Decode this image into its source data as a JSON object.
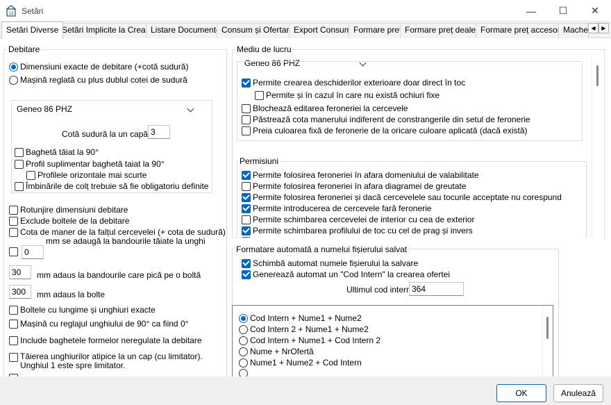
{
  "window": {
    "title": "Setări",
    "minimize_glyph": "—",
    "maximize_glyph": "☐",
    "close_glyph": "✕"
  },
  "tabs": [
    {
      "label": "Setări Diverse"
    },
    {
      "label": "Setări Implicite la Creare"
    },
    {
      "label": "Listare Documente"
    },
    {
      "label": "Consum și Ofertare"
    },
    {
      "label": "Export Consum"
    },
    {
      "label": "Formare preț"
    },
    {
      "label": "Formare preț dealer"
    },
    {
      "label": "Formare preț accesorii"
    },
    {
      "label": "Machet"
    }
  ],
  "tab_scroll": {
    "left": "◀",
    "right": "▶"
  },
  "debitare": {
    "title": "Debitare",
    "radio_exact": "Dimensiuni exacte de debitare (+cotă sudură)",
    "radio_reglata": "Mașină reglată cu plus dublul cotei de sudură",
    "profile_combo": "Geneo 86 PHZ",
    "cota_label": "Cotă sudură la un capăt:",
    "cota_value": "3",
    "bagheta_90": "Baghetă tăiat la 90°",
    "profil_supl": "Profil suplimentar baghetă taiat la 90°",
    "profile_oriz": "Profilele orizontale mai scurte",
    "imbinari": "Îmbinările de colț trebuie să fie obligatoriu definite",
    "rotunjire": "Rotunjire dimensiuni debitare",
    "exclude_boltele": "Exclude boltele de la debitare",
    "cota_maner": "Cota de maner de la falțul cercevelei (+ cota de sudură)",
    "mm_bandouri": "mm se adaugă la bandourile tăiate la unghi",
    "mm_bandouri_value": "0",
    "bolta_value": "30",
    "bolta_label": "mm adaus la bandourile care pică pe o boltă",
    "bolte_value": "300",
    "bolte_label": "mm adaus la bolte",
    "boltele_lungime": "Boltele cu lungime și unghiuri exacte",
    "masina_reglaj": "Mașină cu reglajul unghiului  de 90° ca fiind 0°",
    "include_baghete": "Include baghetele formelor neregulate la debitare",
    "taiere_unghiuri": "Tăierea unghiurilor atipice la un cap (cu limitator). Unghiul 1 este spre limitator."
  },
  "mediu": {
    "title": "Mediu de lucru",
    "profile_combo": "Geneo 86 PHZ",
    "items": [
      {
        "label": "Permite crearea deschiderilor exterioare doar direct în toc",
        "checked": true
      },
      {
        "label": "Permite și în cazul în care nu există ochiuri fixe",
        "checked": false
      },
      {
        "label": "Blochează editarea feroneriei la cercevele",
        "checked": false
      },
      {
        "label": "Păstrează cota manerului indiferent de constrangerile din setul de feronerie",
        "checked": false
      },
      {
        "label": "Preia culoarea fixă de feronerie de la oricare culoare aplicată (dacă există)",
        "checked": false
      }
    ]
  },
  "permisiuni": {
    "title": "Permisiuni",
    "items": [
      {
        "label": "Permite folosirea feroneriei în afara domeniului de valabilitate",
        "checked": true
      },
      {
        "label": "Permite folosirea feroneriei în afara diagramei de greutate",
        "checked": false
      },
      {
        "label": "Permite folosirea feroneriei și dacă cercevelele sau tocurile acceptate nu corespund",
        "checked": true
      },
      {
        "label": "Permite introducerea de cercevele fară feronerie",
        "checked": true
      },
      {
        "label": "Permite schimbarea cercevelei de interior cu cea de exterior",
        "checked": false
      },
      {
        "label": "Permite schimbarea profilului de toc cu cel de prag și invers",
        "checked": true
      }
    ]
  },
  "formatare": {
    "title": "Formatare automată a numelui fișierului salvat",
    "schimba": "Schimbă automat numele fișierului la salvare",
    "genereaza": "Generează automat un \"Cod Intern\" la crearea ofertei",
    "ultimul_label": "Ultimul cod intern:",
    "ultimul_value": "364",
    "options": [
      {
        "label": "Cod Intern + Nume1 + Nume2",
        "checked": true
      },
      {
        "label": "Cod Intern 2 + Nume1 + Nume2",
        "checked": false
      },
      {
        "label": "Cod Intern + Nume1 + Cod Intern 2",
        "checked": false
      },
      {
        "label": "Nume + NrOfertă",
        "checked": false
      },
      {
        "label": "Nume1 + Nume2 + Cod Intern",
        "checked": false
      }
    ]
  },
  "footer": {
    "ok": "OK",
    "cancel": "Anulează"
  }
}
